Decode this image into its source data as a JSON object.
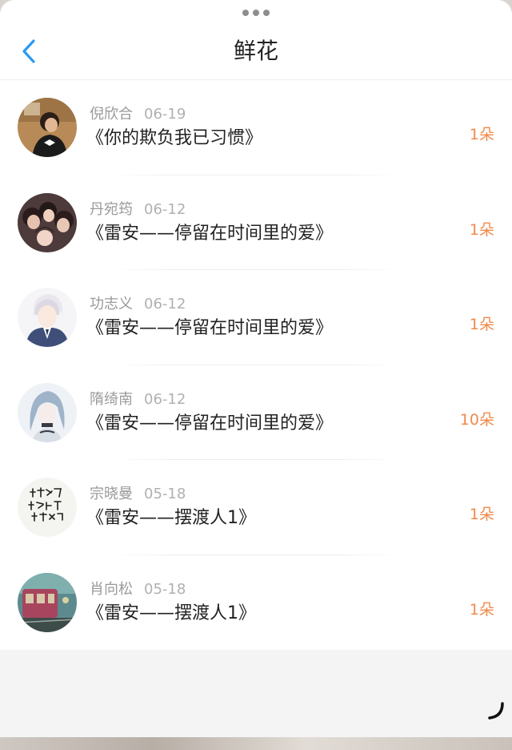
{
  "header": {
    "title": "鲜花",
    "back_icon": "chevron-left-icon",
    "accent_color": "#2b9af3"
  },
  "list": {
    "count_color": "#f08a4b",
    "items": [
      {
        "name": "倪欣合",
        "date": "06-19",
        "work": "《你的欺负我已习惯》",
        "count": "1朵"
      },
      {
        "name": "丹宛筠",
        "date": "06-12",
        "work": "《雷安——停留在时间里的爱》",
        "count": "1朵"
      },
      {
        "name": "功志义",
        "date": "06-12",
        "work": "《雷安——停留在时间里的爱》",
        "count": "1朵"
      },
      {
        "name": "隋绮南",
        "date": "06-12",
        "work": "《雷安——停留在时间里的爱》",
        "count": "10朵"
      },
      {
        "name": "宗晓曼",
        "date": "05-18",
        "work": "《雷安——摆渡人1》",
        "count": "1朵"
      },
      {
        "name": "肖向松",
        "date": "05-18",
        "work": "《雷安——摆渡人1》",
        "count": "1朵"
      }
    ]
  }
}
